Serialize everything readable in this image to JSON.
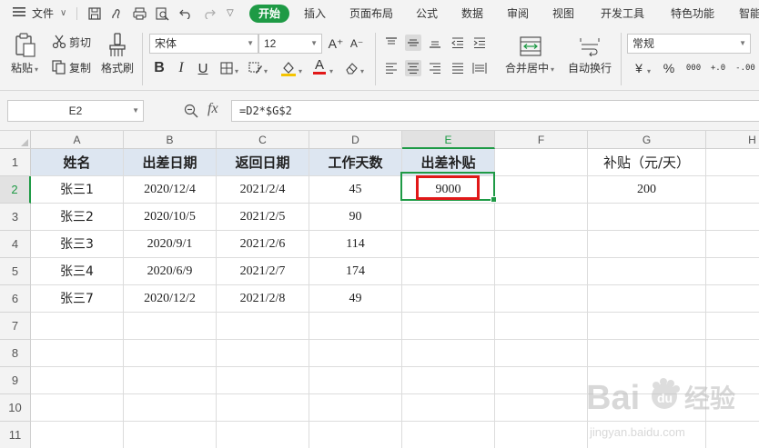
{
  "menubar": {
    "file_label": "文件",
    "tabs": [
      "开始",
      "插入",
      "页面布局",
      "公式",
      "数据",
      "审阅",
      "视图",
      "开发工具",
      "特色功能",
      "智能"
    ]
  },
  "ribbon": {
    "paste_label": "粘贴",
    "cut_label": "剪切",
    "copy_label": "复制",
    "format_painter_label": "格式刷",
    "font_name": "宋体",
    "font_size": "12",
    "merge_center_label": "合并居中",
    "wrap_text_label": "自动换行",
    "number_format": "常规",
    "bold_glyph": "B",
    "italic_glyph": "I",
    "underline_glyph": "U",
    "grow_font_glyph": "A⁺",
    "shrink_font_glyph": "A⁻",
    "font_color_glyph": "A",
    "currency_glyph": "¥",
    "percent_glyph": "%",
    "thousands_glyph": "000",
    "inc_decimal_glyph": "+.0",
    "dec_decimal_glyph": "-.00",
    "accent_color": "#1e9a45"
  },
  "formula_bar": {
    "name_box": "E2",
    "fx_label": "fx",
    "formula": "=D2*$G$2"
  },
  "grid": {
    "columns": [
      "A",
      "B",
      "C",
      "D",
      "E",
      "F",
      "G",
      "H"
    ],
    "rows": [
      "1",
      "2",
      "3",
      "4",
      "5",
      "6",
      "7",
      "8",
      "9",
      "10",
      "11"
    ],
    "headers": [
      "姓名",
      "出差日期",
      "返回日期",
      "工作天数",
      "出差补贴"
    ],
    "data": [
      [
        "张三1",
        "2020/12/4",
        "2021/2/4",
        "45",
        "9000"
      ],
      [
        "张三2",
        "2020/10/5",
        "2021/2/5",
        "90",
        ""
      ],
      [
        "张三3",
        "2020/9/1",
        "2021/2/6",
        "114",
        ""
      ],
      [
        "张三4",
        "2020/6/9",
        "2021/2/7",
        "174",
        ""
      ],
      [
        "张三7",
        "2020/12/2",
        "2021/2/8",
        "49",
        ""
      ]
    ],
    "g1": "补贴（元/天）",
    "g2": "200",
    "selected_cell": "E2",
    "header_fill": "#dde6f1",
    "highlight_color": "#e11818"
  },
  "watermark": {
    "brand": "Bai du 经验",
    "url": "jingyan.baidu.com"
  }
}
